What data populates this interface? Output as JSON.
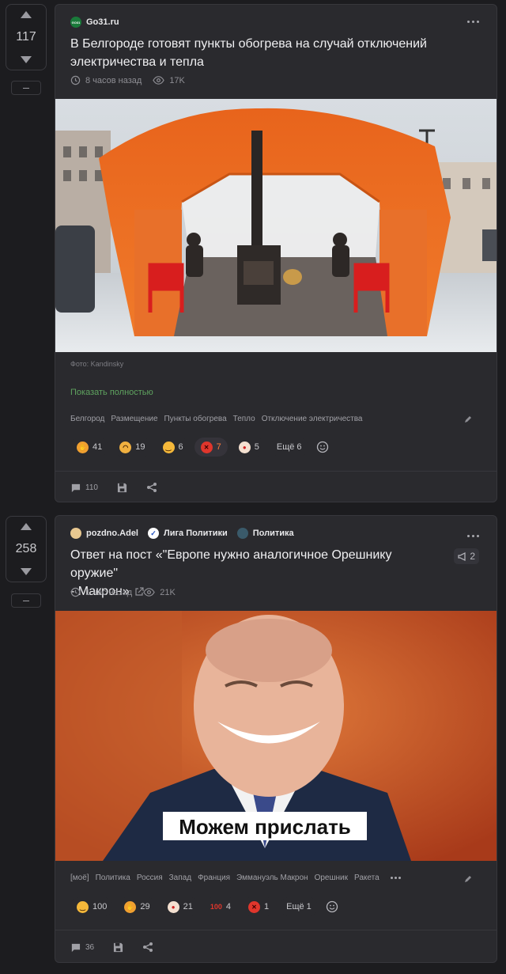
{
  "posts": [
    {
      "score": "117",
      "sources": [
        {
          "name": "Go31.ru",
          "icon_color": "#1a7a3a",
          "icon_text": "GO31"
        }
      ],
      "title_lines": [
        "В Белгороде готовят пункты обогрева на случай отключений",
        "электричества и тепла"
      ],
      "time": "8 часов назад",
      "views": "17K",
      "image_caption": "Фото: Kandinsky",
      "show_full": "Показать полностью",
      "tags": [
        "Белгород",
        "Размещение",
        "Пункты обогрева",
        "Тепло",
        "Отключение электричества"
      ],
      "reactions": [
        {
          "emoji": "laughing",
          "count": "41",
          "color": "#f0a030"
        },
        {
          "emoji": "grinning",
          "count": "19",
          "color": "#f0b040"
        },
        {
          "emoji": "smile",
          "count": "6",
          "color": "#f5b83a"
        },
        {
          "emoji": "angry",
          "count": "7",
          "color": "#e0362c",
          "active": true
        },
        {
          "emoji": "clown",
          "count": "5",
          "color": "#f4e0d0"
        }
      ],
      "more_reactions": "Ещё 6",
      "comments": "110"
    },
    {
      "score": "258",
      "sources": [
        {
          "name": "pozdno.Adel",
          "icon_color": "#e8c890",
          "icon_text": ""
        },
        {
          "name": "Лига Политики",
          "icon_color": "#ffffff",
          "icon_text": "✓"
        },
        {
          "name": "Политика",
          "icon_color": "#3a5a6a",
          "icon_text": ""
        }
      ],
      "title_lines": [
        "Ответ на пост «\"Европе нужно аналогичное Орешнику оружие\"",
        "- Макрон»"
      ],
      "reposts": "2",
      "time": "1 час назад",
      "views": "21K",
      "image_text": "Можем прислать",
      "tags": [
        "[моё]",
        "Политика",
        "Россия",
        "Запад",
        "Франция",
        "Эммануэль Макрон",
        "Орешник",
        "Ракета"
      ],
      "reactions": [
        {
          "emoji": "smile",
          "count": "100",
          "color": "#f5b83a"
        },
        {
          "emoji": "laughing",
          "count": "29",
          "color": "#f0a030"
        },
        {
          "emoji": "clown",
          "count": "21",
          "color": "#f4e0d0"
        },
        {
          "emoji": "100",
          "count": "4",
          "color": "#2a2a2e"
        },
        {
          "emoji": "angry",
          "count": "1",
          "color": "#e0362c"
        }
      ],
      "more_reactions": "Ещё 1",
      "comments": "36"
    }
  ],
  "colors": {
    "accent_green": "#5fa35f",
    "active_count": "#ff7b3b",
    "bg": "#1c1c1f",
    "card": "#2a2a2e"
  }
}
